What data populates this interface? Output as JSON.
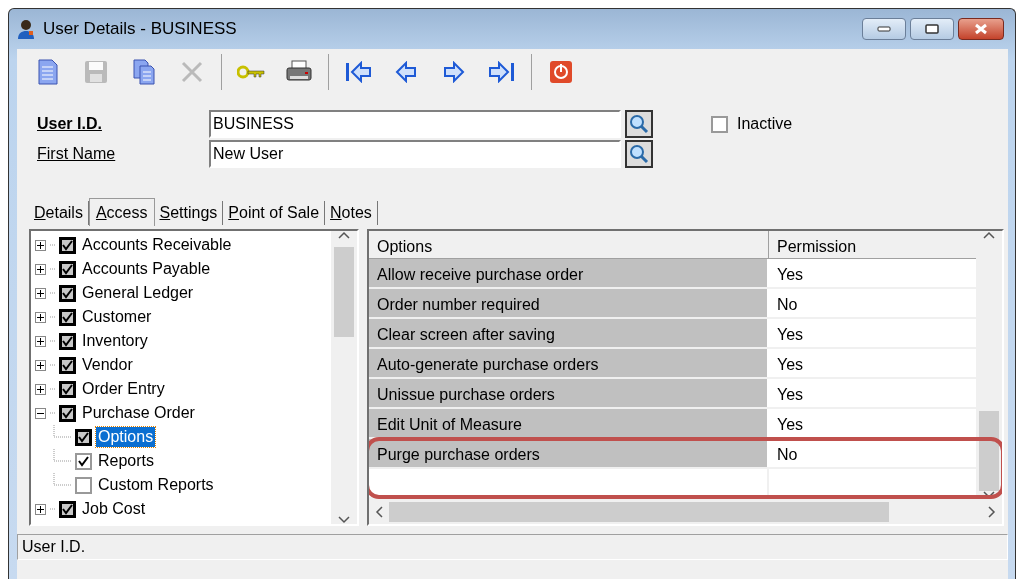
{
  "window": {
    "title": "User Details - BUSINESS"
  },
  "toolbar": [
    {
      "kind": "new",
      "disabled": false
    },
    {
      "kind": "save",
      "disabled": true
    },
    {
      "kind": "copy",
      "disabled": false
    },
    {
      "kind": "delete",
      "disabled": true
    },
    {
      "kind": "separator"
    },
    {
      "kind": "key",
      "disabled": false
    },
    {
      "kind": "print",
      "disabled": false
    },
    {
      "kind": "separator"
    },
    {
      "kind": "first",
      "disabled": false
    },
    {
      "kind": "previous",
      "disabled": false
    },
    {
      "kind": "next",
      "disabled": false
    },
    {
      "kind": "last",
      "disabled": false
    },
    {
      "kind": "separator"
    },
    {
      "kind": "exit",
      "disabled": false
    }
  ],
  "form": {
    "fields": [
      {
        "label": "User I.D.",
        "required": true,
        "value": "BUSINESS"
      },
      {
        "label": "First Name",
        "required": false,
        "value": "New User"
      }
    ],
    "inactive": {
      "label": "Inactive",
      "checked": false
    }
  },
  "tabs": [
    {
      "label": "Details",
      "selected": false
    },
    {
      "label": "Access",
      "selected": true
    },
    {
      "label": "Settings",
      "selected": false
    },
    {
      "label": "Point of Sale",
      "selected": false
    },
    {
      "label": "Notes",
      "selected": false
    }
  ],
  "tree": [
    {
      "label": "Accounts Receivable",
      "checked": true,
      "expanded": false,
      "selected": false
    },
    {
      "label": "Accounts Payable",
      "checked": true,
      "expanded": false,
      "selected": false
    },
    {
      "label": "General Ledger",
      "checked": true,
      "expanded": false,
      "selected": false
    },
    {
      "label": "Customer",
      "checked": true,
      "expanded": false,
      "selected": false
    },
    {
      "label": "Inventory",
      "checked": true,
      "expanded": false,
      "selected": false
    },
    {
      "label": "Vendor",
      "checked": true,
      "expanded": false,
      "selected": false
    },
    {
      "label": "Order Entry",
      "checked": true,
      "expanded": false,
      "selected": false
    },
    {
      "label": "Purchase Order",
      "checked": true,
      "expanded": true,
      "selected": false,
      "children": [
        {
          "label": "Options",
          "checked": true,
          "selected": true
        },
        {
          "label": "Reports",
          "checked": true,
          "selected": false
        },
        {
          "label": "Custom Reports",
          "checked": false,
          "selected": false
        }
      ]
    },
    {
      "label": "Job Cost",
      "checked": true,
      "expanded": false,
      "selected": false
    }
  ],
  "grid": {
    "columns": [
      "Options",
      "Permission"
    ],
    "rows": [
      {
        "option": "Allow receive purchase order",
        "permission": "Yes",
        "highlighted": false
      },
      {
        "option": "Order number required",
        "permission": "No",
        "highlighted": false
      },
      {
        "option": "Clear screen after saving",
        "permission": "Yes",
        "highlighted": false
      },
      {
        "option": "Auto-generate purchase orders",
        "permission": "Yes",
        "highlighted": false
      },
      {
        "option": "Unissue purchase orders",
        "permission": "Yes",
        "highlighted": false
      },
      {
        "option": "Edit Unit of Measure",
        "permission": "Yes",
        "highlighted": false
      },
      {
        "option": "Purge purchase orders",
        "permission": "No",
        "highlighted": true
      }
    ]
  },
  "status_bar": "User I.D."
}
